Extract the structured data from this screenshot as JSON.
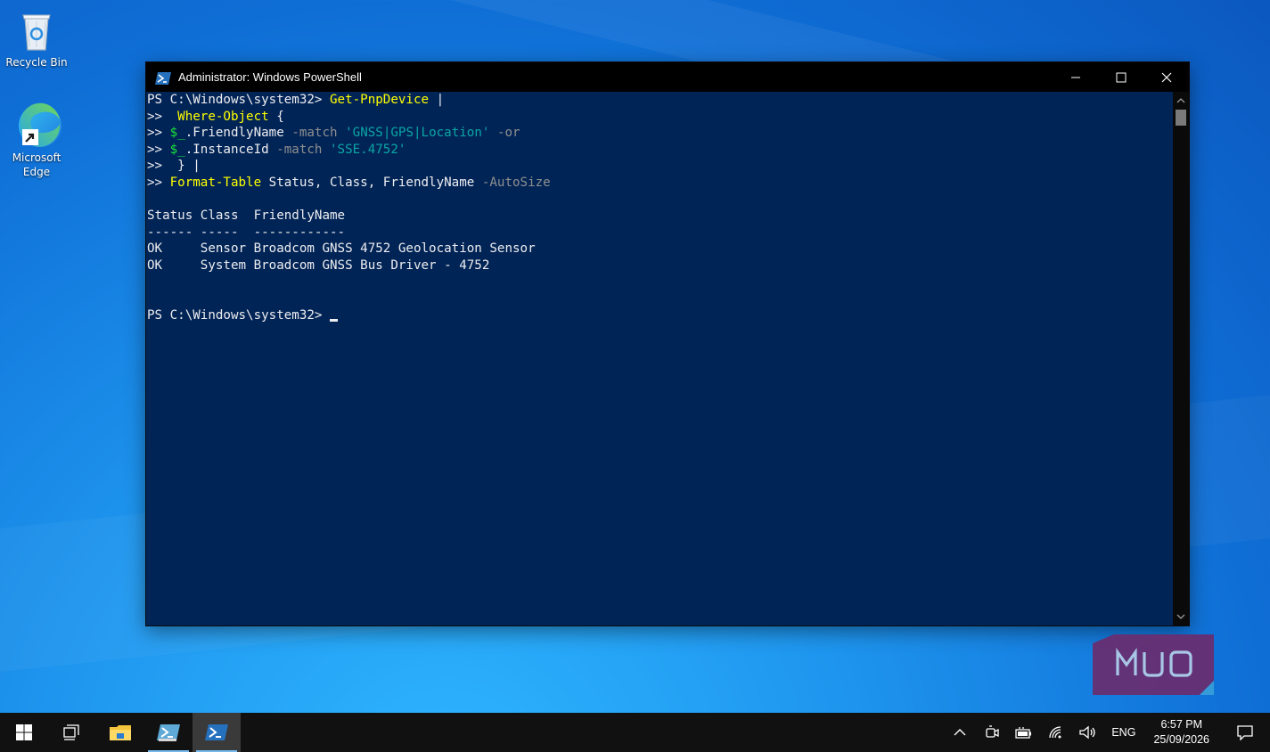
{
  "desktop": {
    "icons": [
      {
        "label": "Recycle Bin"
      },
      {
        "label": "Microsoft Edge"
      }
    ]
  },
  "window": {
    "title": "Administrator: Windows PowerShell",
    "icon": "powershell-icon",
    "controls": [
      "minimize-icon",
      "maximize-icon",
      "close-icon"
    ]
  },
  "console": {
    "prompt": "PS C:\\Windows\\system32> ",
    "cont": ">> ",
    "line1": {
      "cmd": "Get-PnpDevice",
      "rest": " |"
    },
    "line2": {
      "pad": " ",
      "cmd": "Where-Object",
      "rest": " {"
    },
    "line3": {
      "var": "$_",
      "prop": ".FriendlyName ",
      "op": "-match ",
      "str": "'GNSS|GPS|Location'",
      "sp": " ",
      "or": "-or"
    },
    "line4": {
      "var": "$_",
      "prop": ".InstanceId ",
      "op": "-match ",
      "str": "'SSE.4752'"
    },
    "line5": {
      "text": " } |"
    },
    "line6": {
      "cmd": "Format-Table",
      "args": " Status, Class, FriendlyName ",
      "param": "-AutoSize"
    },
    "header": "Status Class  FriendlyName",
    "divider": "------ -----  ------------",
    "rows": [
      "OK     Sensor Broadcom GNSS 4752 Geolocation Sensor",
      "OK     System Broadcom GNSS Bus Driver - 4752"
    ]
  },
  "watermark": {
    "text": "MUO",
    "color": "#6a2d6e"
  },
  "taskbar": {
    "buttons": [
      "windows-start-icon",
      "task-view-icon",
      "file-explorer-icon",
      "powershell-ise-icon",
      "powershell-icon"
    ],
    "tray": {
      "chevron": "chevron-up-icon",
      "icons": [
        "meet-now-icon",
        "battery-icon",
        "wifi-icon",
        "volume-icon"
      ],
      "language": "ENG",
      "time": "6:57 PM",
      "date": "25/09/2026",
      "notifications": "action-center-icon"
    }
  },
  "colors": {
    "console_bg": "#012456",
    "cmdlet": "#ffff00",
    "parameter": "#8f8f8f",
    "string": "#0aa6a6",
    "variable": "#15e33b",
    "taskbar": "#111111"
  }
}
